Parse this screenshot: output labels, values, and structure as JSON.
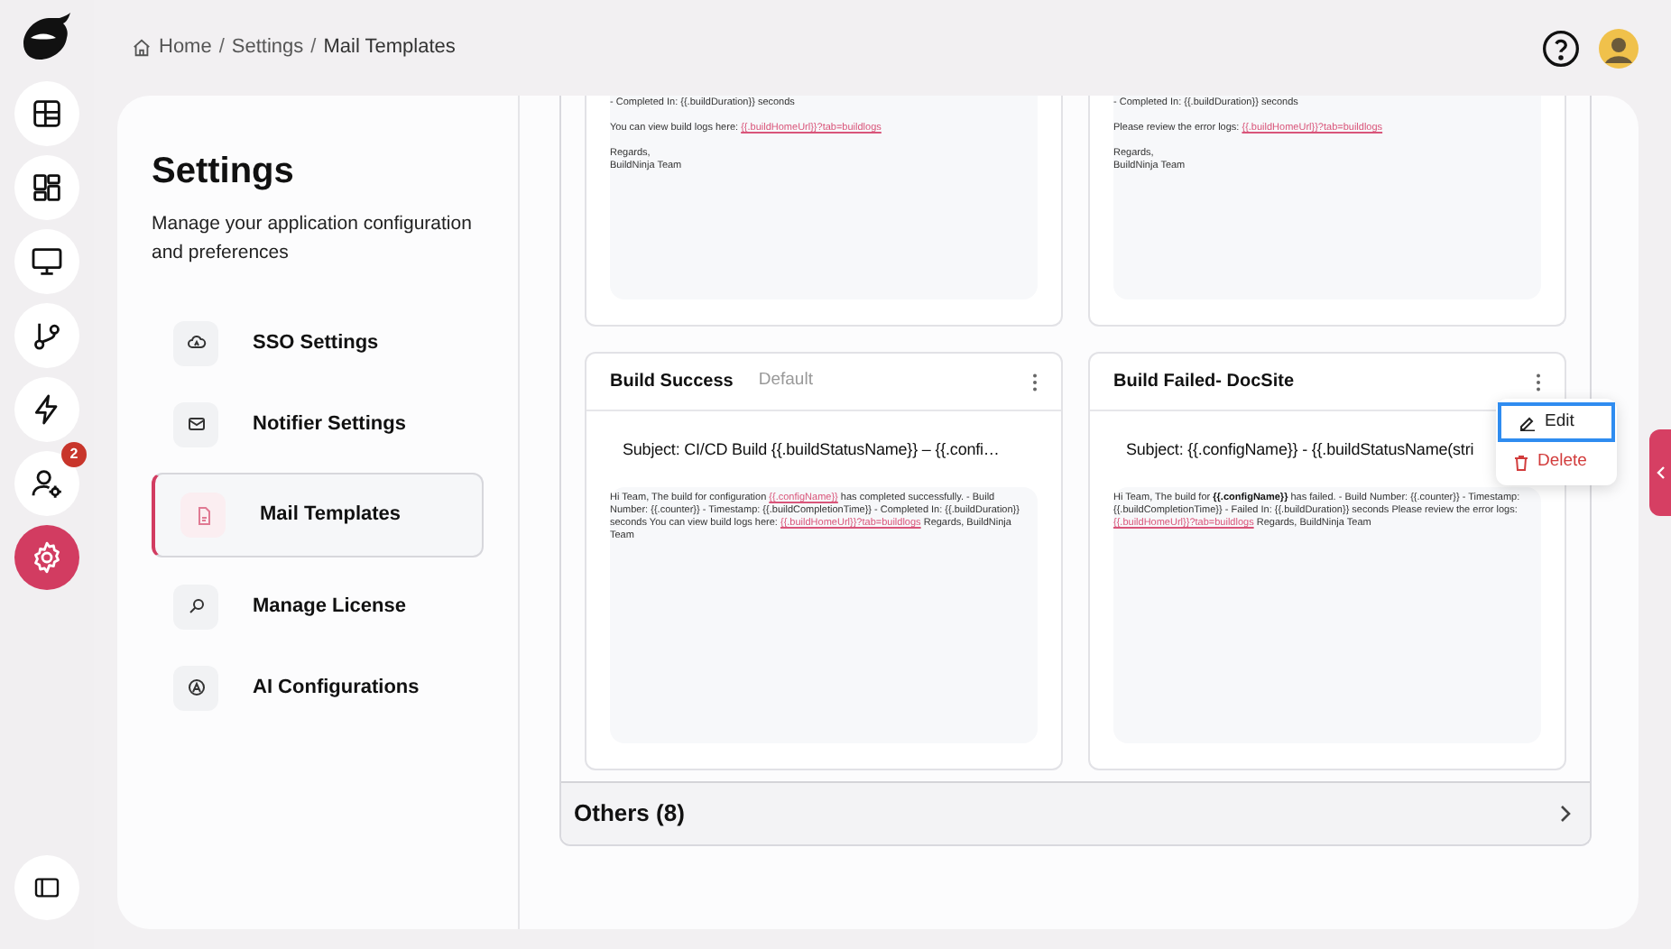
{
  "breadcrumb": [
    {
      "kind": "link",
      "label": "Home"
    },
    {
      "kind": "separator",
      "label": "/"
    },
    {
      "kind": "link",
      "label": "Settings"
    },
    {
      "kind": "separator",
      "label": "/"
    },
    {
      "kind": "current",
      "label": "Mail Templates"
    }
  ],
  "rail": [
    {
      "selected": false
    },
    {
      "selected": false
    },
    {
      "selected": false
    },
    {
      "selected": false
    },
    {
      "selected": false
    },
    {
      "selected": false,
      "badge": "2"
    },
    {
      "selected": true
    }
  ],
  "settings": {
    "title": "Settings",
    "description": "Manage your application configuration and preferences",
    "items": [
      {
        "label": "SSO Settings",
        "selected": false
      },
      {
        "label": "Notifier Settings",
        "selected": false
      },
      {
        "label": "Mail Templates",
        "selected": true
      },
      {
        "label": "Manage License",
        "selected": false
      },
      {
        "label": "AI Configurations",
        "selected": false
      }
    ]
  },
  "top_templates": [
    {
      "paragraphs": [
        {
          "lines": [
            "- Completed In: {{.buildDuration}} seconds"
          ]
        },
        {
          "lines": [
            "You can view build logs here:"
          ],
          "link": "{{.buildHomeUrl}}?tab=buildlogs"
        },
        {
          "lines": [
            "Regards,",
            "BuildNinja Team"
          ]
        }
      ]
    },
    {
      "paragraphs": [
        {
          "lines": [
            "- Completed In: {{.buildDuration}} seconds"
          ]
        },
        {
          "lines": [
            "Please review the error logs:"
          ],
          "link": "{{.buildHomeUrl}}?tab=buildlogs"
        },
        {
          "lines": [
            "Regards,",
            "BuildNinja Team"
          ]
        }
      ]
    }
  ],
  "templates": [
    {
      "title": "Build Success",
      "tag": "Default",
      "subject": "Subject: CI/CD Build {{.buildStatusName}} – {{.confi…",
      "body": [
        {
          "kind": "plain",
          "text": "Hi Team, The build for configuration "
        },
        {
          "kind": "link",
          "text": "{{.configName}}"
        },
        {
          "kind": "plain",
          "text": " has completed successfully. - Build Number: {{.counter}} - Timestamp: {{.buildCompletionTime}} - Completed In: {{.buildDuration}} seconds You can view build logs here: "
        },
        {
          "kind": "link",
          "text": "{{.buildHomeUrl}}?tab=buildlogs"
        },
        {
          "kind": "plain",
          "text": " Regards, BuildNinja Team"
        }
      ]
    },
    {
      "title": "Build Failed- DocSite",
      "subject": "Subject: {{.configName}} - {{.buildStatusName(stri",
      "body": [
        {
          "kind": "plain",
          "text": "Hi Team, The build for "
        },
        {
          "kind": "bold",
          "text": "{{.configName}}"
        },
        {
          "kind": "plain",
          "text": " has failed. - Build Number: {{.counter}} - Timestamp: {{.buildCompletionTime}} - Failed In: {{.buildDuration}} seconds Please review the error logs: "
        },
        {
          "kind": "link",
          "text": "{{.buildHomeUrl}}?tab=buildlogs"
        },
        {
          "kind": "plain",
          "text": " Regards, BuildNinja Team"
        }
      ]
    }
  ],
  "menu": {
    "items": [
      {
        "label": "Edit",
        "kind": "edit",
        "focused": true
      },
      {
        "label": "Delete",
        "kind": "delete",
        "focused": false
      }
    ]
  },
  "others": {
    "label": "Others (8)"
  }
}
